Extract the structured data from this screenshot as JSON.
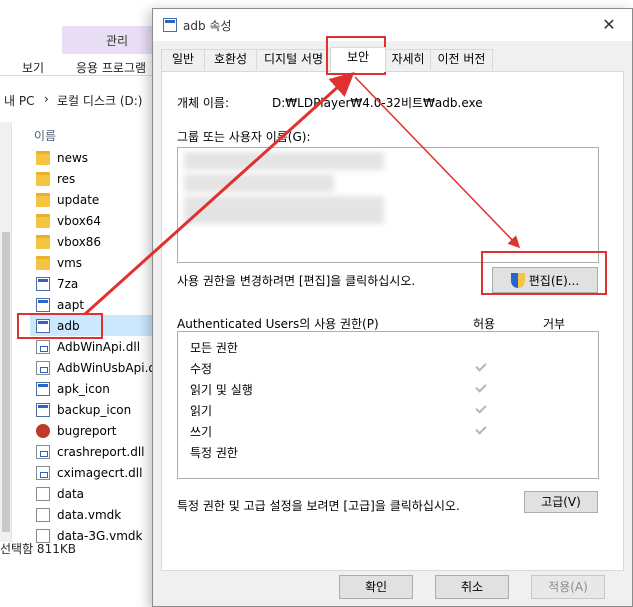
{
  "explorer": {
    "ribbon_manage": "관리",
    "tab_view": "보기",
    "tab_app_tools": "응용 프로그램",
    "breadcrumb_pc": "내 PC",
    "breadcrumb_sep": "›",
    "breadcrumb_disk": "로컬 디스크 (D:)",
    "column_name": "이름",
    "files": [
      {
        "name": "news",
        "icon": "folder-icon"
      },
      {
        "name": "res",
        "icon": "folder-icon"
      },
      {
        "name": "update",
        "icon": "folder-icon"
      },
      {
        "name": "vbox64",
        "icon": "folder-icon"
      },
      {
        "name": "vbox86",
        "icon": "folder-icon"
      },
      {
        "name": "vms",
        "icon": "folder-icon"
      },
      {
        "name": "7za",
        "icon": "exe-icon"
      },
      {
        "name": "aapt",
        "icon": "exe-icon"
      },
      {
        "name": "adb",
        "icon": "exe-icon"
      },
      {
        "name": "AdbWinApi.dll",
        "icon": "dll-icon"
      },
      {
        "name": "AdbWinUsbApi.dll",
        "icon": "dll-icon"
      },
      {
        "name": "apk_icon",
        "icon": "exe-icon"
      },
      {
        "name": "backup_icon",
        "icon": "exe-icon"
      },
      {
        "name": "bugreport",
        "icon": "bug-icon"
      },
      {
        "name": "crashreport.dll",
        "icon": "dll-icon"
      },
      {
        "name": "cximagecrt.dll",
        "icon": "dll-icon"
      },
      {
        "name": "data",
        "icon": "file-icon"
      },
      {
        "name": "data.vmdk",
        "icon": "file-icon"
      },
      {
        "name": "data-3G.vmdk",
        "icon": "file-icon"
      }
    ],
    "status_selected": "선택함 811KB"
  },
  "dialog": {
    "title": "adb 속성",
    "close_glyph": "✕",
    "tabs": [
      {
        "label": "일반"
      },
      {
        "label": "호환성"
      },
      {
        "label": "디지털 서명"
      },
      {
        "label": "보안"
      },
      {
        "label": "자세히"
      },
      {
        "label": "이전 버전"
      }
    ],
    "object_name_label": "개체 이름:",
    "object_name_value": "D:₩LDPlayer₩4.0-32비트₩adb.exe",
    "group_label": "그룹 또는 사용자 이름(G):",
    "edit_hint": "사용 권한을 변경하려면 [편집]을 클릭하십시오.",
    "edit_button": "편집(E)...",
    "permissions_label": "Authenticated Users의 사용 권한(P)",
    "allow_header": "허용",
    "deny_header": "거부",
    "permissions": [
      {
        "name": "모든 권한",
        "allow": false
      },
      {
        "name": "수정",
        "allow": true
      },
      {
        "name": "읽기 및 실행",
        "allow": true
      },
      {
        "name": "읽기",
        "allow": true
      },
      {
        "name": "쓰기",
        "allow": true
      },
      {
        "name": "특정 권한",
        "allow": false
      }
    ],
    "advanced_hint": "특정 권한 및 고급 설정을 보려면 [고급]을 클릭하십시오.",
    "advanced_button": "고급(V)",
    "ok_button": "확인",
    "cancel_button": "취소",
    "apply_button": "적용(A)"
  },
  "colors": {
    "annotation": "#e03131",
    "selection": "#cce8ff",
    "ribbon_highlight": "#e9dff5"
  }
}
